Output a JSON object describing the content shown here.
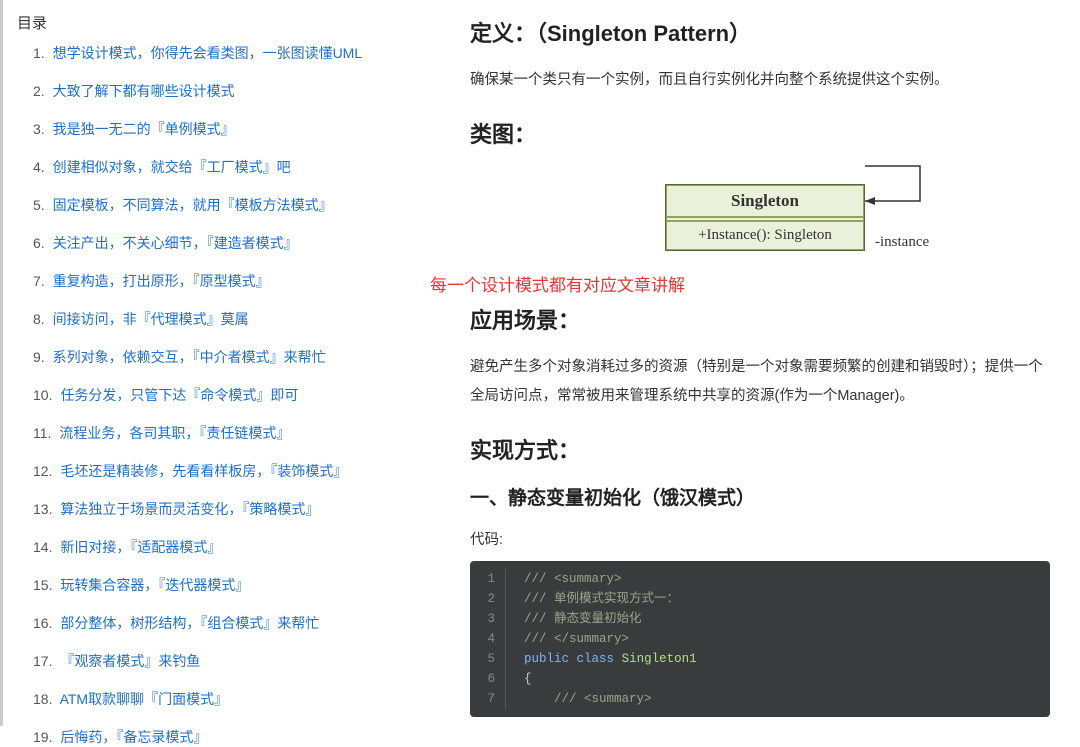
{
  "toc": {
    "title": "目录",
    "items": [
      "想学设计模式，你得先会看类图，一张图读懂UML",
      "大致了解下都有哪些设计模式",
      "我是独一无二的『单例模式』",
      "创建相似对象，就交给『工厂模式』吧",
      "固定模板，不同算法，就用『模板方法模式』",
      "关注产出，不关心细节，『建造者模式』",
      "重复构造，打出原形，『原型模式』",
      "间接访问，非『代理模式』莫属",
      "系列对象，依赖交互，『中介者模式』来帮忙",
      "任务分发，只管下达『命令模式』即可",
      "流程业务，各司其职，『责任链模式』",
      "毛坯还是精装修，先看看样板房，『装饰模式』",
      "算法独立于场景而灵活变化，『策略模式』",
      "新旧对接，『适配器模式』",
      "玩转集合容器，『迭代器模式』",
      "部分整体，树形结构，『组合模式』来帮忙",
      "『观察者模式』来钓鱼",
      "ATM取款聊聊『门面模式』",
      "后悔药，『备忘录模式』"
    ]
  },
  "article": {
    "def_heading": "定义：（Singleton Pattern）",
    "def_body": "确保某一个类只有一个实例，而且自行实例化并向整个系统提供这个实例。",
    "diagram_heading": "类图：",
    "annotation": "每一个设计模式都有对应文章讲解",
    "uml": {
      "className": "Singleton",
      "method": "+Instance(): Singleton",
      "assoc_label": "-instance"
    },
    "scene_heading": "应用场景：",
    "scene_body": "避免产生多个对象消耗过多的资源（特别是一个对象需要频繁的创建和销毁时）；提供一个全局访问点，常常被用来管理系统中共享的资源(作为一个Manager)。",
    "impl_heading": "实现方式：",
    "impl_sub": "一、静态变量初始化（饿汉模式）",
    "code_label": "代码:",
    "code": [
      {
        "n": 1,
        "html": "<span class='cm'>/// &lt;summary&gt;</span>"
      },
      {
        "n": 2,
        "html": "<span class='cm'>/// 单例模式实现方式一：</span>"
      },
      {
        "n": 3,
        "html": "<span class='cm'>/// 静态变量初始化</span>"
      },
      {
        "n": 4,
        "html": "<span class='cm'>/// &lt;/summary&gt;</span>"
      },
      {
        "n": 5,
        "html": "<span class='kw-blue'>public</span> <span class='kw-blue'>class</span> <span class='kw-class'>Singleton1</span>"
      },
      {
        "n": 6,
        "html": "{"
      },
      {
        "n": 7,
        "html": "    <span class='cm'>/// &lt;summary&gt;</span>"
      }
    ]
  }
}
